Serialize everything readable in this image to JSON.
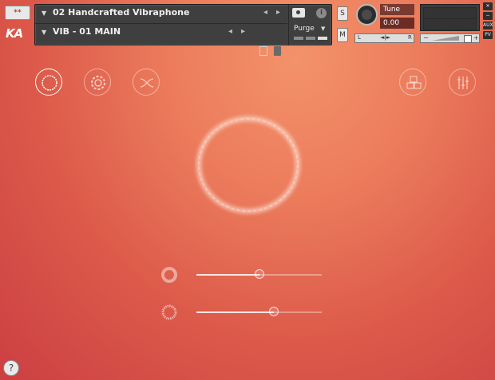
{
  "header": {
    "logo_btn": "**",
    "brand": "KA",
    "instrument_name": "02 Handcrafted Vibraphone",
    "snapshot_name": "VIB - 01 MAIN",
    "purge_label": "Purge",
    "solo_label": "S",
    "mute_label": "M",
    "tune_label": "Tune",
    "tune_value": "0.00",
    "pan_left": "L",
    "pan_center": "◄|►",
    "pan_right": "R",
    "vol_minus": "−",
    "vol_plus": "+",
    "win_close": "✕",
    "win_min": "−",
    "win_aux": "AUX",
    "win_pv": "PV",
    "nav_left": "◂",
    "nav_right": "▸",
    "dropdown_arrow": "▼",
    "info": "i"
  },
  "main": {
    "left_icons": [
      "ring-icon",
      "gear-icon",
      "crossfade-icon"
    ],
    "right_icons": [
      "cubes-icon",
      "mixer-icon"
    ],
    "sliders": [
      {
        "icon": "ring-soft-icon",
        "value": 0.5
      },
      {
        "icon": "ring-noise-icon",
        "value": 0.62
      }
    ]
  },
  "footer": {
    "help_label": "?"
  },
  "colors": {
    "background_top": "#f3926a",
    "background_bottom": "#cc3f42",
    "header_bg": "#3f3f3f"
  }
}
